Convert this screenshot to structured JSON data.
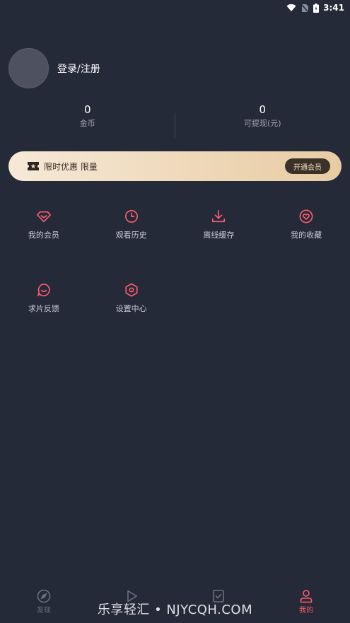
{
  "status_bar": {
    "time": "3:41"
  },
  "profile": {
    "login_label": "登录/注册"
  },
  "stats": [
    {
      "value": "0",
      "label": "金币"
    },
    {
      "value": "0",
      "label": "可提现(元)"
    }
  ],
  "vip_banner": {
    "promo_text": "限时优惠 限量",
    "button_label": "开通会员"
  },
  "menu": [
    {
      "label": "我的会员",
      "icon": "diamond-icon"
    },
    {
      "label": "观看历史",
      "icon": "clock-icon"
    },
    {
      "label": "离线缓存",
      "icon": "download-icon"
    },
    {
      "label": "我的收藏",
      "icon": "heart-icon"
    },
    {
      "label": "求片反馈",
      "icon": "chat-smile-icon"
    },
    {
      "label": "设置中心",
      "icon": "settings-hex-icon"
    }
  ],
  "bottom_nav": [
    {
      "label": "发现",
      "icon": "compass-icon"
    },
    {
      "label": "",
      "icon": "play-icon"
    },
    {
      "label": "",
      "icon": "checklist-icon"
    },
    {
      "label": "我的",
      "icon": "user-icon"
    }
  ],
  "watermark": "乐享轻汇 • NJYCQH.COM",
  "colors": {
    "background": "#252a39",
    "accent": "#ff5c6d",
    "vip_gradient_start": "#f6e9d7",
    "vip_gradient_end": "#e8cba2"
  }
}
